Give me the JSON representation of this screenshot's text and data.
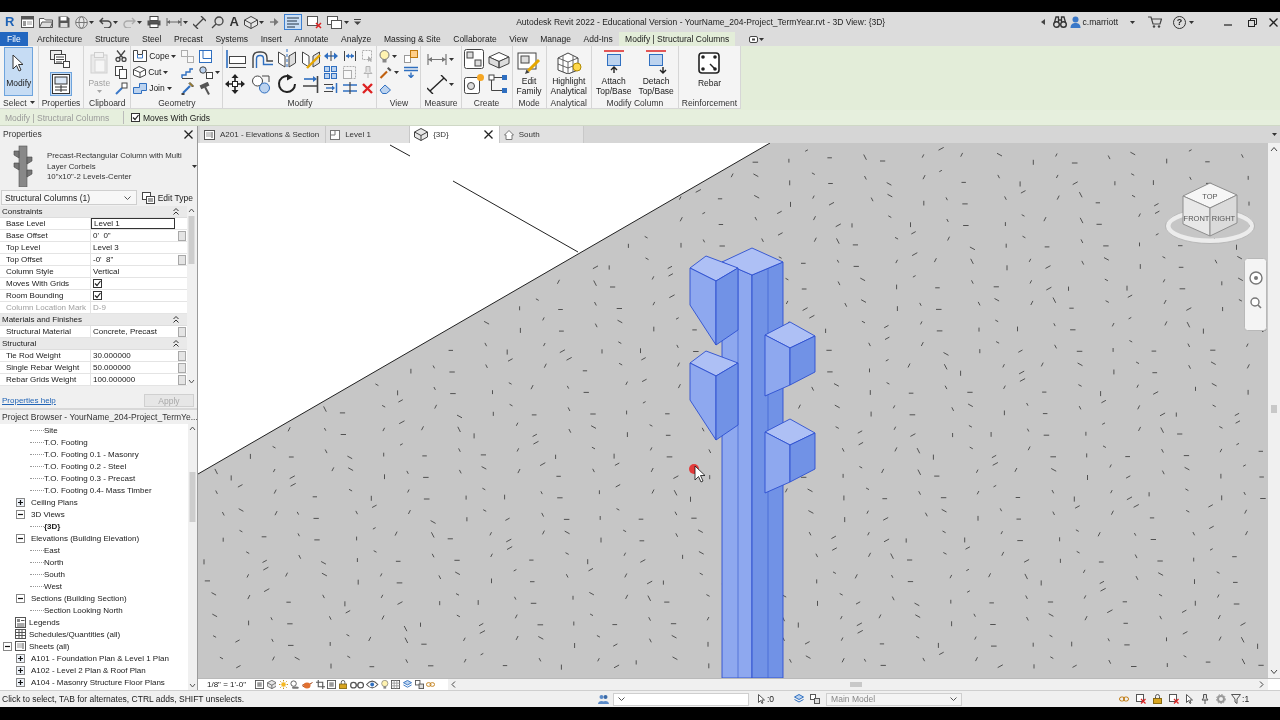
{
  "title_bar": {
    "logo": "R",
    "text_tool": "A",
    "thin_lines": true,
    "title": "Autodesk Revit 2022 - Educational Version - YourName_204-Project_TermYear.rvt - 3D View: {3D}",
    "user": "c.marriott",
    "help": "?"
  },
  "ribbon_tabs": [
    {
      "label": "File",
      "kind": "file",
      "selected": false
    },
    {
      "label": "Architecture",
      "kind": "tab",
      "selected": false
    },
    {
      "label": "Structure",
      "kind": "tab",
      "selected": false
    },
    {
      "label": "Steel",
      "kind": "tab",
      "selected": false
    },
    {
      "label": "Precast",
      "kind": "tab",
      "selected": false
    },
    {
      "label": "Systems",
      "kind": "tab",
      "selected": false
    },
    {
      "label": "Insert",
      "kind": "tab",
      "selected": false
    },
    {
      "label": "Annotate",
      "kind": "tab",
      "selected": false
    },
    {
      "label": "Analyze",
      "kind": "tab",
      "selected": false
    },
    {
      "label": "Massing & Site",
      "kind": "tab",
      "selected": false
    },
    {
      "label": "Collaborate",
      "kind": "tab",
      "selected": false
    },
    {
      "label": "View",
      "kind": "tab",
      "selected": false
    },
    {
      "label": "Manage",
      "kind": "tab",
      "selected": false
    },
    {
      "label": "Add-Ins",
      "kind": "tab",
      "selected": false
    },
    {
      "label": "Modify | Structural Columns",
      "kind": "contextual",
      "selected": true
    }
  ],
  "ribbon_panels": [
    {
      "title": "Select",
      "dropdown": true,
      "tools": [
        {
          "kind": "large",
          "label": "Modify",
          "selected": true
        }
      ]
    },
    {
      "title": "Properties",
      "dropdown": false,
      "tools": [
        {
          "kind": "bigicon"
        },
        {
          "kind": "bigicon",
          "selected": true
        }
      ]
    },
    {
      "title": "Clipboard",
      "dropdown": false,
      "tools": [
        {
          "kind": "large",
          "label": "Paste",
          "disabled": true,
          "menu": true
        },
        {
          "kind": "icon"
        },
        {
          "kind": "icon"
        },
        {
          "kind": "icon"
        }
      ]
    },
    {
      "title": "Geometry",
      "dropdown": false,
      "tools": [
        {
          "kind": "small",
          "label": "Cope",
          "menu": true
        },
        {
          "kind": "small",
          "label": "Cut",
          "menu": true
        },
        {
          "kind": "small",
          "label": "Join",
          "menu": true
        },
        {
          "kind": "icon",
          "disabled": true
        },
        {
          "kind": "icon"
        },
        {
          "kind": "icon"
        },
        {
          "kind": "icon"
        },
        {
          "kind": "icon",
          "menu": true
        },
        {
          "kind": "icon"
        }
      ]
    },
    {
      "title": "Modify",
      "dropdown": false,
      "tools": [
        {
          "kind": "bigicon"
        },
        {
          "kind": "bigicon"
        },
        {
          "kind": "bigicon"
        },
        {
          "kind": "bigicon"
        },
        {
          "kind": "bigicon"
        },
        {
          "kind": "bigicon"
        },
        {
          "kind": "bigicon"
        },
        {
          "kind": "bigicon"
        },
        {
          "kind": "icon"
        },
        {
          "kind": "icon"
        },
        {
          "kind": "icon"
        },
        {
          "kind": "icon"
        },
        {
          "kind": "icon",
          "disabled": true
        },
        {
          "kind": "icon"
        },
        {
          "kind": "icon",
          "disabled": true
        },
        {
          "kind": "icon",
          "disabled": true
        },
        {
          "kind": "icon"
        }
      ]
    },
    {
      "title": "View",
      "dropdown": false,
      "tools": [
        {
          "kind": "icon",
          "menu": true
        },
        {
          "kind": "icon",
          "menu": true
        },
        {
          "kind": "icon"
        },
        {
          "kind": "icon"
        },
        {
          "kind": "icon"
        }
      ]
    },
    {
      "title": "Measure",
      "dropdown": false,
      "tools": [
        {
          "kind": "bigicon",
          "menu": true
        },
        {
          "kind": "bigicon",
          "menu": true
        }
      ]
    },
    {
      "title": "Create",
      "dropdown": false,
      "tools": [
        {
          "kind": "bigicon"
        },
        {
          "kind": "bigicon"
        },
        {
          "kind": "bigicon"
        },
        {
          "kind": "bigicon"
        }
      ]
    },
    {
      "title": "Mode",
      "dropdown": false,
      "tools": [
        {
          "kind": "large",
          "label": "Edit Family"
        }
      ]
    },
    {
      "title": "Analytical",
      "dropdown": false,
      "tools": [
        {
          "kind": "large",
          "label": "Highlight Analytical"
        }
      ]
    },
    {
      "title": "Modify Column",
      "dropdown": false,
      "tools": [
        {
          "kind": "large",
          "label": "Attach Top/Base"
        },
        {
          "kind": "large",
          "label": "Detach Top/Base"
        }
      ]
    },
    {
      "title": "Reinforcement",
      "dropdown": false,
      "tools": [
        {
          "kind": "large",
          "label": "Rebar"
        }
      ]
    }
  ],
  "options_bar": {
    "context": "Modify | Structural Columns",
    "moves_with_grids": {
      "label": "Moves With Grids",
      "checked": true
    }
  },
  "properties": {
    "title": "Properties",
    "type_name": "Precast-Rectangular Column with Multi Layer Corbels",
    "type_size": "10\"x10\"-2 Levels-Center",
    "filter": "Structural Columns (1)",
    "edit_type": "Edit Type",
    "groups": [
      {
        "title": "Constraints",
        "expanded": true,
        "rows": [
          {
            "name": "Base Level",
            "value": "Level 1",
            "kind": "text",
            "editing": true,
            "param_button": false
          },
          {
            "name": "Base Offset",
            "value": "0'  0\"",
            "kind": "text",
            "param_button": true
          },
          {
            "name": "Top Level",
            "value": "Level 3",
            "kind": "text",
            "param_button": false
          },
          {
            "name": "Top Offset",
            "value": "-0'  8\"",
            "kind": "text",
            "param_button": true
          },
          {
            "name": "Column Style",
            "value": "Vertical",
            "kind": "text",
            "param_button": false
          },
          {
            "name": "Moves With Grids",
            "kind": "checkbox",
            "checked": true,
            "param_button": false
          },
          {
            "name": "Room Bounding",
            "kind": "checkbox",
            "checked": true,
            "param_button": false
          },
          {
            "name": "Column Location Mark",
            "value": "D-9",
            "kind": "text",
            "disabled": true,
            "param_button": false
          }
        ]
      },
      {
        "title": "Materials and Finishes",
        "expanded": true,
        "rows": [
          {
            "name": "Structural Material",
            "value": "Concrete, Precast",
            "kind": "text",
            "param_button": true
          }
        ]
      },
      {
        "title": "Structural",
        "expanded": true,
        "rows": [
          {
            "name": "Tie Rod Weight",
            "value": "30.000000",
            "kind": "text",
            "param_button": true
          },
          {
            "name": "Single Rebar Weight",
            "value": "50.000000",
            "kind": "text",
            "param_button": true
          },
          {
            "name": "Rebar Grids Weight",
            "value": "100.000000",
            "kind": "text",
            "param_button": true
          }
        ]
      }
    ],
    "help_link": "Properties help",
    "apply": {
      "label": "Apply",
      "disabled": true
    }
  },
  "project_browser": {
    "title": "Project Browser - YourName_204-Project_TermYe...",
    "nodes": [
      {
        "children": [
          {
            "children": [
              {
                "label": "Site",
                "active": false
              },
              {
                "label": "T.O. Footing",
                "active": false
              },
              {
                "label": "T.O. Footing 0.1 - Masonry",
                "active": false
              },
              {
                "label": "T.O. Footing 0.2 - Steel",
                "active": false
              },
              {
                "label": "T.O. Footing 0.3 - Precast",
                "active": false
              },
              {
                "label": "T.O. Footing 0.4- Mass Timber",
                "active": false
              }
            ]
          },
          {
            "label": "Ceiling Plans",
            "expanded": false
          },
          {
            "label": "3D Views",
            "expanded": true,
            "children": [
              {
                "label": "{3D}",
                "active": true
              }
            ]
          },
          {
            "label": "Elevations (Building Elevation)",
            "expanded": true,
            "children": [
              {
                "label": "East",
                "active": false
              },
              {
                "label": "North",
                "active": false
              },
              {
                "label": "South",
                "active": false
              },
              {
                "label": "West",
                "active": false
              }
            ]
          },
          {
            "label": "Sections (Building Section)",
            "expanded": true,
            "children": [
              {
                "label": "Section Looking North",
                "active": false
              }
            ]
          }
        ]
      },
      {
        "label": "Legends",
        "kind": "legend"
      },
      {
        "label": "Schedules/Quantities (all)",
        "kind": "schedule"
      },
      {
        "label": "Sheets (all)",
        "kind": "sheet",
        "expanded": true,
        "children": [
          {
            "label": "A101 - Foundation Plan & Level 1 Plan",
            "expanded": false
          },
          {
            "label": "A102 - Level 2 Plan & Roof Plan",
            "expanded": false
          },
          {
            "label": "A104 - Masonry Structure Floor Plans",
            "expanded": false
          }
        ]
      }
    ]
  },
  "view_tabs": [
    {
      "label": "A201 - Elevations & Section",
      "kind": "sheet",
      "selected": false
    },
    {
      "label": "Level 1",
      "kind": "plan",
      "selected": false
    },
    {
      "label": "{3D}",
      "kind": "model",
      "selected": true
    },
    {
      "label": "South",
      "kind": "elevation",
      "selected": false
    }
  ],
  "view": {
    "view_cube": [
      "TOP",
      "FRONT",
      "RIGHT"
    ]
  },
  "view_bar": {
    "scale": "1/8\" = 1'-0\""
  },
  "status_bar": {
    "message": "Click to select, TAB for alternates, CTRL adds, SHIFT unselects.",
    "pick_count": ":0",
    "model": "Main Model",
    "filter_count": ":1"
  }
}
